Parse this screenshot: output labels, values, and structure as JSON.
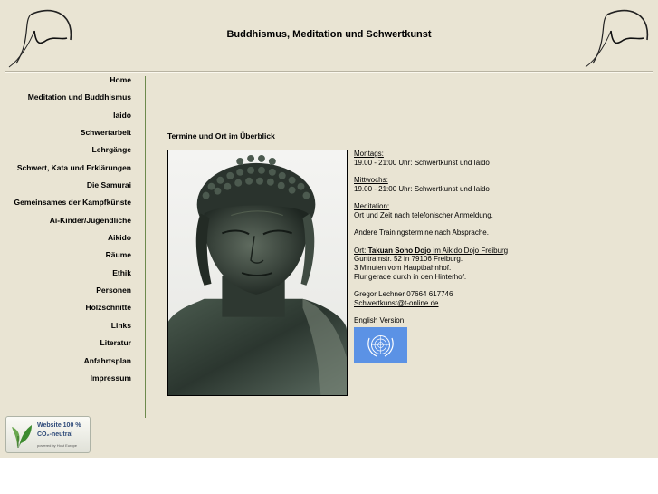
{
  "site": {
    "title": "Buddhismus, Meditation und Schwertkunst"
  },
  "nav": {
    "items": [
      {
        "label": "Home"
      },
      {
        "label": "Meditation und Buddhismus"
      },
      {
        "label": "Iaido"
      },
      {
        "label": "Schwertarbeit"
      },
      {
        "label": "Lehrgänge"
      },
      {
        "label": "Schwert, Kata und Erklärungen"
      },
      {
        "label": "Die Samurai"
      },
      {
        "label": "Gemeinsames der Kampfkünste"
      },
      {
        "label": "Ai-Kinder/Jugendliche"
      },
      {
        "label": "Aikido"
      },
      {
        "label": "Räume"
      },
      {
        "label": "Ethik"
      },
      {
        "label": "Personen"
      },
      {
        "label": "Holzschnitte"
      },
      {
        "label": "Links"
      },
      {
        "label": "Literatur"
      },
      {
        "label": "Anfahrtsplan"
      },
      {
        "label": "Impressum"
      }
    ]
  },
  "main": {
    "heading": "Termine und Ort im Überblick",
    "monday": {
      "label": "Montags:",
      "text": "19.00 - 21:00 Uhr: Schwertkunst und Iaido"
    },
    "wednesday": {
      "label": "Mittwochs:",
      "text": "19.00 - 21:00 Uhr: Schwertkunst und Iaido"
    },
    "meditation": {
      "label": "Meditation:",
      "text": "Ort und Zeit nach telefonischer Anmeldung."
    },
    "other": "Andere Trainingstermine nach Absprache.",
    "location": {
      "prefix": "Ort: ",
      "dojo": "Takuan Soho Dojo",
      "suffix": " im Aikido Dojo Freiburg",
      "street": "Guntramstr. 52 in 79106 Freiburg.",
      "distance": "3 Minuten vom Hauptbahnhof.",
      "directions": "Flur gerade durch in den Hinterhof."
    },
    "contact": {
      "name_phone": "Gregor Lechner 07664 617746",
      "email": "Schwertkunst@t-online.de"
    },
    "english_version": "English Version",
    "flag_icon": "un-flag-icon"
  },
  "badge": {
    "line1": "Website 100 %",
    "line2": "CO₂-neutral",
    "line3": "powered by Host Europe"
  },
  "colors": {
    "background": "#e9e4d3",
    "divider": "#6d8a4d",
    "un_blue": "#5b92e5"
  }
}
